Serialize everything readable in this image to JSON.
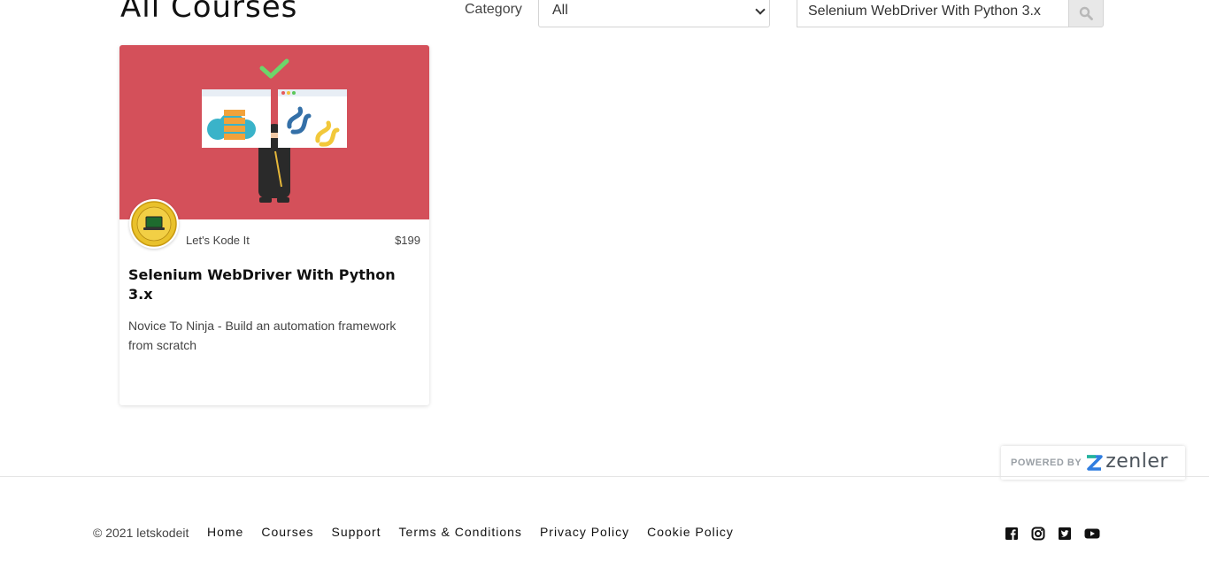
{
  "header": {
    "title": "All Courses",
    "category_label": "Category",
    "category_selected": "All",
    "search_value": "Selenium WebDriver With Python 3.x"
  },
  "course": {
    "author": "Let's Kode It",
    "price": "$199",
    "title": "Selenium WebDriver With Python 3.x",
    "description": "Novice To Ninja - Build an automation framework from scratch"
  },
  "badge": {
    "powered_by": "POWERED BY",
    "brand": "zenler"
  },
  "footer": {
    "copyright": "© 2021 letskodeit",
    "links": [
      "Home",
      "Courses",
      "Support",
      "Terms & Conditions",
      "Privacy Policy",
      "Cookie Policy"
    ]
  },
  "social": [
    "facebook-icon",
    "instagram-icon",
    "twitter-icon",
    "youtube-icon"
  ],
  "colors": {
    "card_image_bg": "#d4505a",
    "footer_divider": "#e5e5e5"
  }
}
